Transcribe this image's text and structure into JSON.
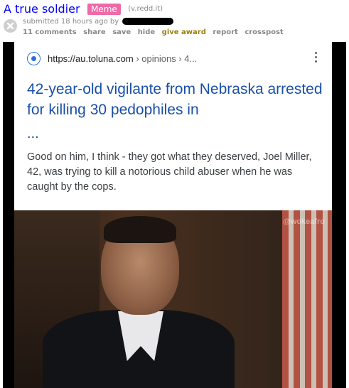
{
  "post": {
    "title": "A true soldier",
    "flair": "Meme",
    "domain": "(v.redd.it)",
    "tagline": "submitted 18 hours ago by",
    "buttons": {
      "comments": "11 comments",
      "share": "share",
      "save": "save",
      "hide": "hide",
      "give_award": "give award",
      "report": "report",
      "crosspost": "crosspost"
    }
  },
  "video": {
    "card": {
      "url": "https://au.toluna.com",
      "breadcrumbs": "› opinions › 4...",
      "headline": "42-year-old vigilante from Nebraska arrested for killing 30 pedophiles in",
      "ellipsis": "...",
      "snippet": "Good on him, I think - they got what they deserved, Joel Miller, 42, was trying to kill a notorious child abuser when he was caught by the cops."
    },
    "watermark": "@wokeafro"
  },
  "colors": {
    "title_link": "#0000ff",
    "flair_bg": "#ee6aa7",
    "headline": "#1a4fa8",
    "award": "#9a7d0a"
  }
}
